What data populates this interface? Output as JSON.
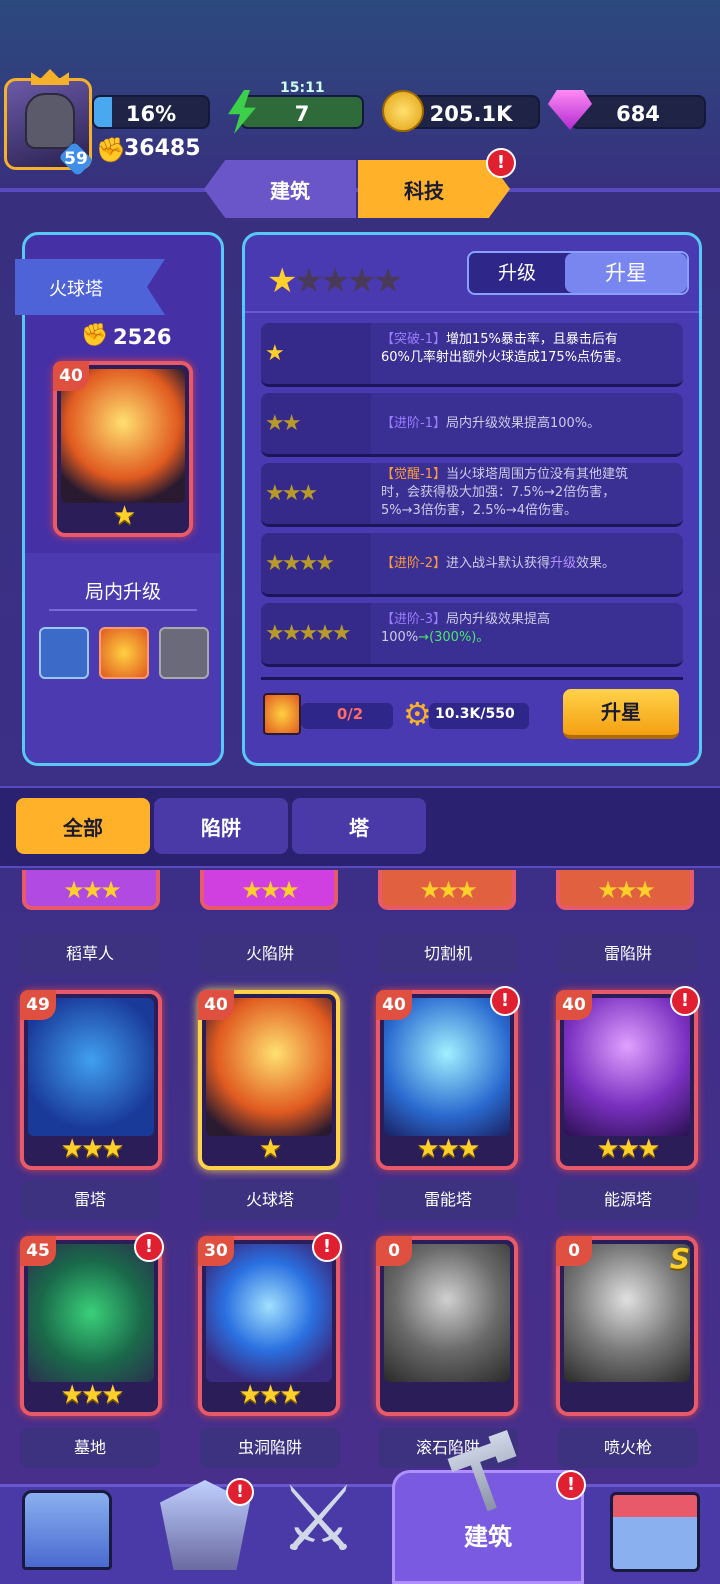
{
  "header": {
    "level": "59",
    "progress": "16%",
    "power": "36485",
    "energy_timer": "15:11",
    "energy": "7",
    "gold": "205.1K",
    "gems": "684"
  },
  "tabs": {
    "build": "建筑",
    "tech": "科技"
  },
  "tower": {
    "name": "火球塔",
    "power": "2526",
    "level": "40",
    "in_game_upgrade": "局内升级"
  },
  "mode_tabs": {
    "upgrade": "升级",
    "star": "升星"
  },
  "star_rows": [
    {
      "tag": "【突破-1】",
      "line1": "增加15%暴击率，且暴击后有",
      "line2": "60%几率射出额外火球造成175%点伤害。"
    },
    {
      "tag": "【进阶-1】",
      "line1": "局内升级效果提高100%。"
    },
    {
      "tag": "【觉醒-1】",
      "line1": "当火球塔周围方位没有其他建筑",
      "line2": "时，会获得极大加强：7.5%→2倍伤害，",
      "line3": "5%→3倍伤害，2.5%→4倍伤害。"
    },
    {
      "tag": "【进阶-2】",
      "line1": "进入战斗默认获得",
      "highlight": "升级",
      "line1b": "效果。"
    },
    {
      "tag": "【进阶-3】",
      "line1": "局内升级效果提高",
      "line2": "100%",
      "line2b": "→(300%)。"
    }
  ],
  "cost": {
    "cards": "0/2",
    "gears": "10.3K/550",
    "button": "升星"
  },
  "filters": {
    "all": "全部",
    "trap": "陷阱",
    "tower": "塔"
  },
  "top_labels": [
    "稻草人",
    "火陷阱",
    "切割机",
    "雷陷阱"
  ],
  "cards_row1": [
    {
      "level": "49",
      "name": "雷塔"
    },
    {
      "level": "40",
      "name": "火球塔"
    },
    {
      "level": "40",
      "name": "雷能塔"
    },
    {
      "level": "40",
      "name": "能源塔"
    }
  ],
  "cards_row2": [
    {
      "level": "45",
      "name": "墓地"
    },
    {
      "level": "30",
      "name": "虫洞陷阱"
    },
    {
      "level": "0",
      "name": "滚石陷阱"
    },
    {
      "level": "0",
      "name": "喷火枪"
    }
  ],
  "stars": {
    "full": "★★★",
    "five": "★★★★★",
    "one": "★",
    "two": "★★",
    "three": "★★★",
    "four": "★★★★",
    "row_top_left": "★",
    "row_top_right": "★★★★"
  },
  "nav": {
    "build": "建筑"
  },
  "alert_mark": "!",
  "s_badge": "S"
}
